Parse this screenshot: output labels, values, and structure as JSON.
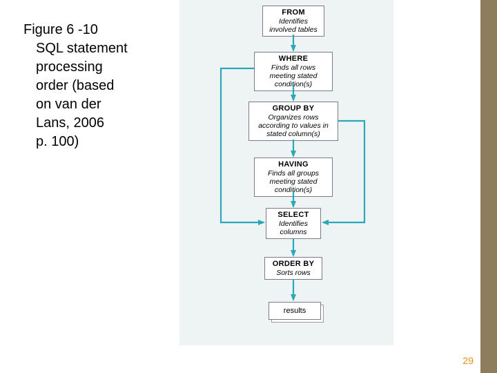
{
  "caption": {
    "line1": "Figure 6 -10",
    "line2": "SQL statement",
    "line3": "processing",
    "line4": "order  (based",
    "line5": "on van der",
    "line6": "Lans, 2006",
    "line7": "p. 100)"
  },
  "page_number": "29",
  "colors": {
    "arrow": "#2aa7b8",
    "box_border": "#7a7a8a",
    "panel_bg": "#eef4f4",
    "sidebar": "#8e7c5d",
    "pagenum": "#e0921a"
  },
  "nodes": {
    "from": {
      "title": "FROM",
      "desc": "Identifies involved tables"
    },
    "where": {
      "title": "WHERE",
      "desc": "Finds all rows meeting stated condition(s)"
    },
    "group": {
      "title": "GROUP BY",
      "desc": "Organizes rows according to values in stated column(s)"
    },
    "having": {
      "title": "HAVING",
      "desc": "Finds all groups meeting stated condition(s)"
    },
    "select": {
      "title": "SELECT",
      "desc": "Identifies columns"
    },
    "order": {
      "title": "ORDER BY",
      "desc": "Sorts rows"
    }
  },
  "results_label": "results",
  "flow": [
    {
      "from": "from",
      "to": "where"
    },
    {
      "from": "where",
      "to": "group"
    },
    {
      "from": "group",
      "to": "having"
    },
    {
      "from": "having",
      "to": "select"
    },
    {
      "from": "select",
      "to": "order"
    },
    {
      "from": "order",
      "to": "results"
    }
  ],
  "skips": [
    {
      "from": "where",
      "to": "select",
      "side": "left"
    },
    {
      "from": "group",
      "to": "select",
      "side": "right"
    }
  ]
}
